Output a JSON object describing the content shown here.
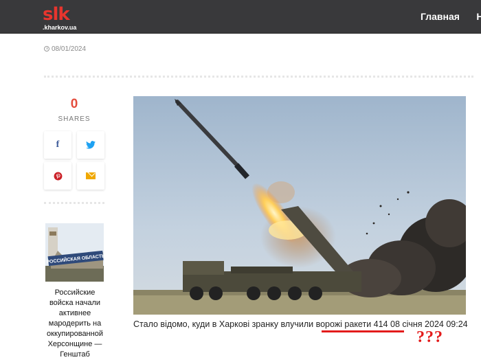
{
  "header": {
    "logo_mark": "slk",
    "logo_domain": ".kharkov.ua",
    "nav": [
      "Главная",
      "Н"
    ]
  },
  "meta": {
    "date": "08/01/2024"
  },
  "share": {
    "count": "0",
    "label": "SHARES",
    "buttons": [
      {
        "icon": "facebook-icon",
        "glyph": "f"
      },
      {
        "icon": "twitter-icon",
        "glyph": "🐦"
      },
      {
        "icon": "pinterest-icon",
        "glyph": "℗"
      },
      {
        "icon": "mail-icon",
        "glyph": ""
      }
    ]
  },
  "related": {
    "thumb_sign": "РОССИЙСКАЯ ОБЛАСТЬ",
    "title": "Российские войска начали активнее мародерить на оккупированной Херсонщине — Генштаб"
  },
  "article": {
    "caption_before": "Стало відомо, куди в Харкові зранку влучили ",
    "caption_highlight": "ворожі ракети 414",
    "caption_after": " 08 січня 2024 09:24",
    "annotation": "???"
  },
  "colors": {
    "topbar": "#39393b",
    "accent_red": "#e44c3c",
    "annotation_red": "#e31b1b"
  }
}
